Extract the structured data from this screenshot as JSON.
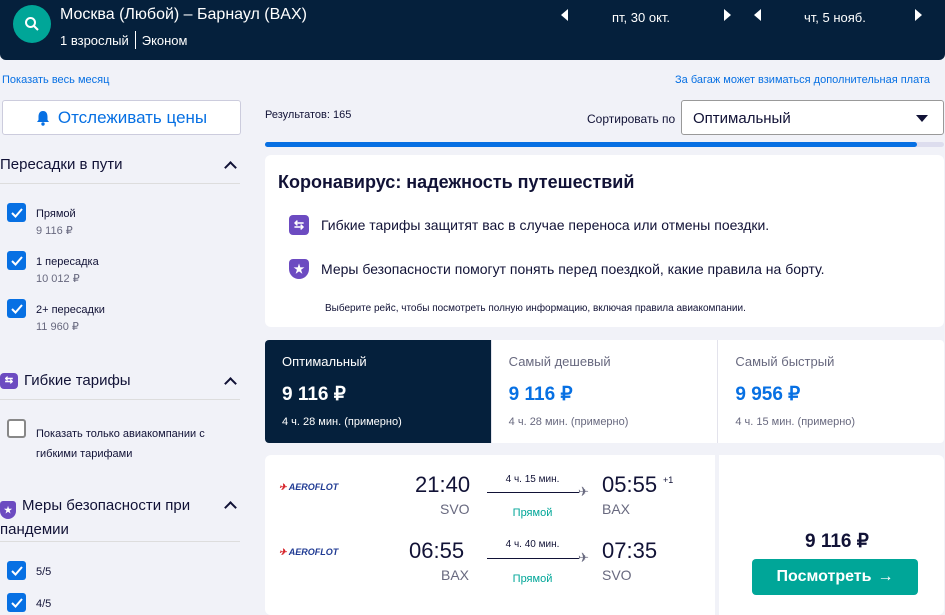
{
  "search": {
    "route": "Москва (Любой) – Барнаул (BAX)",
    "passengers": "1 взрослый",
    "cabin": "Эконом",
    "depart_date": "пт, 30 окт.",
    "return_date": "чт, 5 нояб."
  },
  "links": {
    "show_month": "Показать весь месяц",
    "baggage_note": "За багаж может взиматься дополнительная плата"
  },
  "track_prices_label": "Отслеживать цены",
  "filters": {
    "stops_title": "Пересадки в пути",
    "stops": [
      {
        "label": "Прямой",
        "price": "9 116 ₽",
        "checked": true
      },
      {
        "label": "1 пересадка",
        "price": "10 012 ₽",
        "checked": true
      },
      {
        "label": "2+ пересадки",
        "price": "11 960 ₽",
        "checked": true
      }
    ],
    "flex_title": "Гибкие тарифы",
    "flex_option": "Показать только авиакомпании с гибкими тарифами",
    "safety_title": "Меры безопасности при пандемии",
    "safety": [
      {
        "label": "5/5",
        "checked": true
      },
      {
        "label": "4/5",
        "checked": true
      }
    ]
  },
  "results_count": "Результатов: 165",
  "sort": {
    "label": "Сортировать по",
    "value": "Оптимальный"
  },
  "progress": 0.96,
  "covid": {
    "title": "Коронавирус: надежность путешествий",
    "line1": "Гибкие тарифы защитят вас в случае переноса или отмены поездки.",
    "line2": "Меры безопасности помогут понять перед поездкой, какие правила на борту.",
    "note": "Выберите рейс, чтобы посмотреть полную информацию, включая правила авиакомпании."
  },
  "tabs": [
    {
      "title": "Оптимальный",
      "price": "9 116 ₽",
      "duration": "4 ч. 28 мин. (примерно)"
    },
    {
      "title": "Самый дешевый",
      "price": "9 116 ₽",
      "duration": "4 ч. 28 мин. (примерно)"
    },
    {
      "title": "Самый быстрый",
      "price": "9 956 ₽",
      "duration": "4 ч. 15 мин. (примерно)"
    }
  ],
  "result": {
    "airline": "AEROFLOT",
    "outbound": {
      "dep_time": "21:40",
      "dep_code": "SVO",
      "duration": "4 ч. 15 мин.",
      "stops": "Прямой",
      "arr_time": "05:55",
      "arr_plus": "+1",
      "arr_code": "BAX"
    },
    "inbound": {
      "dep_time": "06:55",
      "dep_code": "BAX",
      "duration": "4 ч. 40 мин.",
      "stops": "Прямой",
      "arr_time": "07:35",
      "arr_code": "SVO"
    },
    "price": "9 116 ₽",
    "view_label": "Посмотреть"
  },
  "colors": {
    "navy": "#05203c",
    "accent": "#0770e3",
    "teal": "#00a698",
    "purple": "#6c4bc1"
  }
}
